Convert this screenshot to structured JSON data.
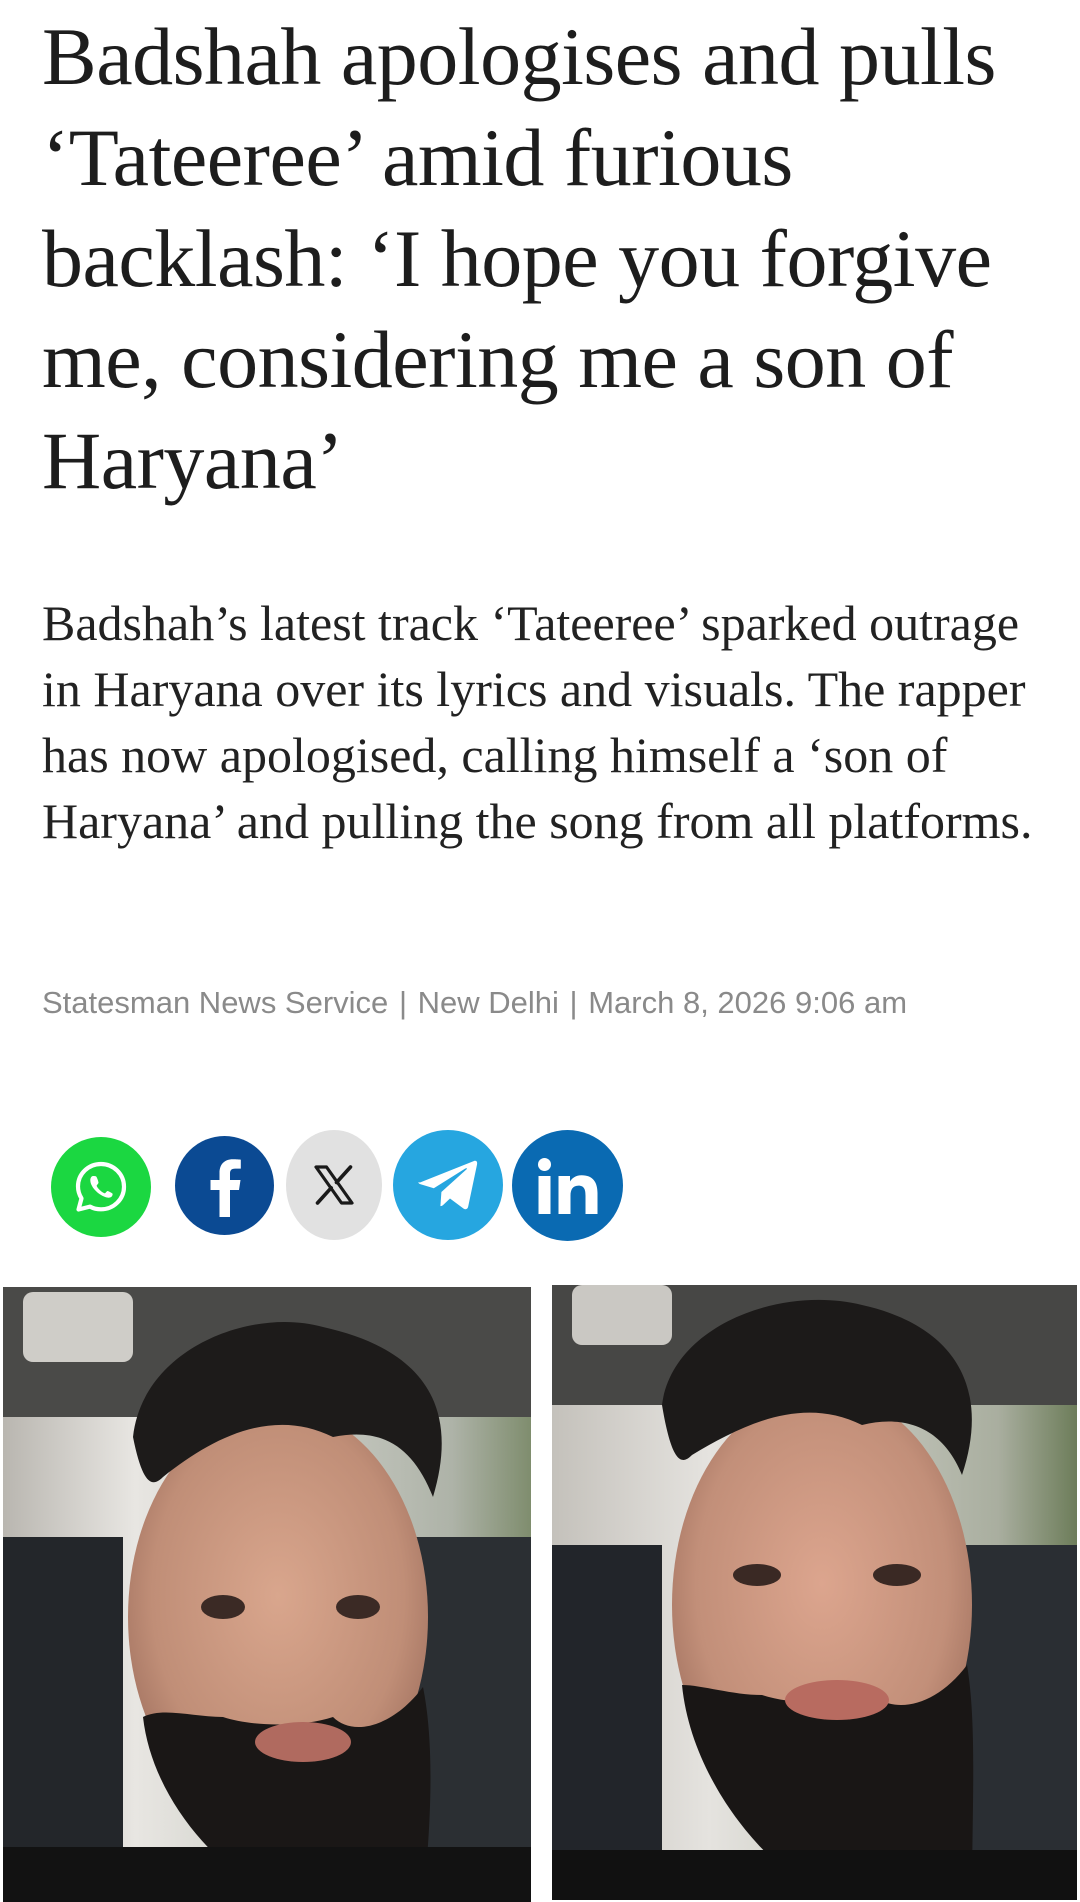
{
  "article": {
    "headline": "Badshah apologises and pulls ‘Tateeree’ amid furious backlash: ‘I hope you forgive me, considering me a son of Haryana’",
    "summary": "Badshah’s latest track ‘Tateeree’ sparked outrage in Haryana over its lyrics and visuals. The rapper has now apologised, calling himself a ‘son of Haryana’ and pulling the song from all platforms.",
    "byline": {
      "source": "Statesman News Service",
      "location": "New Delhi",
      "datetime": "March 8, 2026 9:06 am",
      "separator": "|"
    }
  },
  "share": {
    "buttons": [
      {
        "name": "WhatsApp",
        "icon": "whatsapp-icon",
        "color": "#1bd741"
      },
      {
        "name": "Facebook",
        "icon": "facebook-icon",
        "color": "#0b4a93"
      },
      {
        "name": "X",
        "icon": "x-icon",
        "color": "#e1e1e1"
      },
      {
        "name": "Telegram",
        "icon": "telegram-icon",
        "color": "#26a6e0"
      },
      {
        "name": "LinkedIn",
        "icon": "linkedin-icon",
        "color": "#0a6ab2"
      }
    ]
  },
  "images": [
    {
      "name": "featured-photo-left",
      "description_icon": "person-photo"
    },
    {
      "name": "featured-photo-right",
      "description_icon": "person-photo"
    }
  ]
}
